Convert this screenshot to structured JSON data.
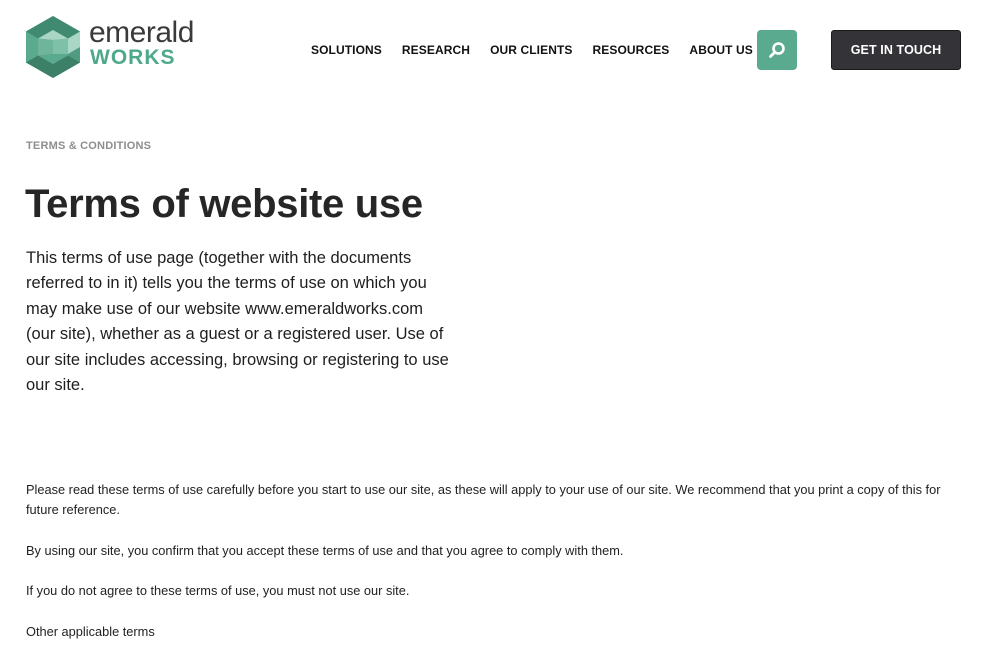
{
  "brand": {
    "name_top": "emerald",
    "name_bottom": "WORKS",
    "accent_color": "#5aaa8f"
  },
  "nav": {
    "items": [
      {
        "label": "SOLUTIONS"
      },
      {
        "label": "RESEARCH"
      },
      {
        "label": "OUR CLIENTS"
      },
      {
        "label": "RESOURCES"
      },
      {
        "label": "ABOUT US"
      }
    ],
    "search_icon": "search-icon",
    "cta_label": "GET IN TOUCH"
  },
  "page": {
    "eyebrow": "TERMS & CONDITIONS",
    "title": "Terms of website use",
    "intro": "This terms of use page (together with the documents referred to in it) tells you the terms of use on which you may make use of our website www.emeraldworks.com (our site), whether as a guest or a registered user. Use of our site includes accessing, browsing or registering to use our site.",
    "paragraphs": [
      "Please read these terms of use carefully before you start to use our site, as these will apply to your use of our site. We recommend that you print a copy of this for future reference.",
      "By using our site, you confirm that you accept these terms of use and that you agree to comply with them.",
      "If you do not agree to these terms of use, you must not use our site.",
      "Other applicable terms"
    ]
  }
}
